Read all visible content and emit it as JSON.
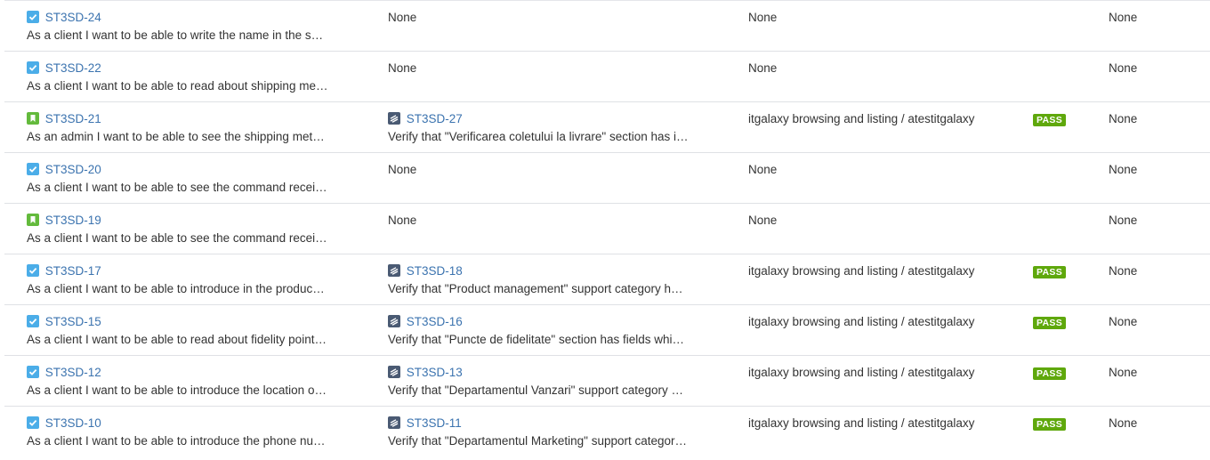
{
  "rows": [
    {
      "issue": {
        "type": "story",
        "key": "ST3SD-24",
        "summary": "As a client I want to be able to write the name in the s…"
      },
      "test": null,
      "test_none": "None",
      "execution": "None",
      "status": null,
      "defects": "None"
    },
    {
      "issue": {
        "type": "story",
        "key": "ST3SD-22",
        "summary": "As a client I want to be able to read about shipping me…"
      },
      "test": null,
      "test_none": "None",
      "execution": "None",
      "status": null,
      "defects": "None"
    },
    {
      "issue": {
        "type": "bookmark",
        "key": "ST3SD-21",
        "summary": "As an admin I want to be able to see the shipping met…"
      },
      "test": {
        "key": "ST3SD-27",
        "summary": "Verify that \"Verificarea coletului la livrare\" section has i…"
      },
      "execution": "itgalaxy browsing and listing / atestitgalaxy",
      "status": "PASS",
      "defects": "None"
    },
    {
      "issue": {
        "type": "story",
        "key": "ST3SD-20",
        "summary": "As a client I want to be able to see the command recei…"
      },
      "test": null,
      "test_none": "None",
      "execution": "None",
      "status": null,
      "defects": "None"
    },
    {
      "issue": {
        "type": "bookmark",
        "key": "ST3SD-19",
        "summary": "As a client I want to be able to see the command recei…"
      },
      "test": null,
      "test_none": "None",
      "execution": "None",
      "status": null,
      "defects": "None"
    },
    {
      "issue": {
        "type": "story",
        "key": "ST3SD-17",
        "summary": "As a client I want to be able to introduce in the produc…"
      },
      "test": {
        "key": "ST3SD-18",
        "summary": "Verify that \"Product management\" support category h…"
      },
      "execution": "itgalaxy browsing and listing / atestitgalaxy",
      "status": "PASS",
      "defects": "None"
    },
    {
      "issue": {
        "type": "story",
        "key": "ST3SD-15",
        "summary": "As a client I want to be able to read about fidelity point…"
      },
      "test": {
        "key": "ST3SD-16",
        "summary": "Verify that \"Puncte de fidelitate\" section has fields whi…"
      },
      "execution": "itgalaxy browsing and listing / atestitgalaxy",
      "status": "PASS",
      "defects": "None"
    },
    {
      "issue": {
        "type": "story",
        "key": "ST3SD-12",
        "summary": "As a client I want to be able to introduce the location o…"
      },
      "test": {
        "key": "ST3SD-13",
        "summary": "Verify that \"Departamentul Vanzari\" support category …"
      },
      "execution": "itgalaxy browsing and listing / atestitgalaxy",
      "status": "PASS",
      "defects": "None"
    },
    {
      "issue": {
        "type": "story",
        "key": "ST3SD-10",
        "summary": "As a client I want to be able to introduce the phone nu…"
      },
      "test": {
        "key": "ST3SD-11",
        "summary": "Verify that \"Departamentul Marketing\" support categor…"
      },
      "execution": "itgalaxy browsing and listing / atestitgalaxy",
      "status": "PASS",
      "defects": "None"
    }
  ],
  "colors": {
    "link": "#3b73af",
    "story_icon": "#4bade8",
    "bookmark_icon": "#63ba3c",
    "test_icon": "#4a5a73",
    "pass_badge": "#5fa80c"
  }
}
